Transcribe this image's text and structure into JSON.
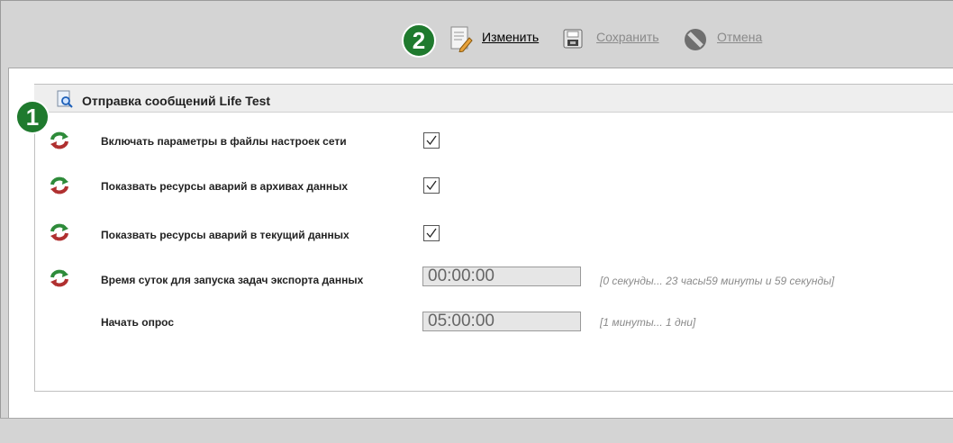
{
  "toolbar": {
    "badge": "2",
    "edit_label": "Изменить",
    "save_label": "Сохранить",
    "cancel_label": "Отмена"
  },
  "panel": {
    "badge": "1",
    "title": "Отправка сообщений Life Test"
  },
  "rows": [
    {
      "label": "Включать параметры  в файлы настроек сети",
      "type": "checkbox",
      "checked": true
    },
    {
      "label": "Показвать ресурсы аварий в архивах данных",
      "type": "checkbox",
      "checked": true
    },
    {
      "label": "Показвать ресурсы аварий в текущий данных",
      "type": "checkbox",
      "checked": true
    },
    {
      "label": "Время суток для запуска задач экспорта данных",
      "type": "field",
      "value": "00:00:00",
      "hint": "[0 секунды... 23 часы59 минуты и 59 секунды]"
    },
    {
      "label": "Начать опрос",
      "type": "field",
      "value": "05:00:00",
      "hint": "[1 минуты... 1 дни]"
    }
  ],
  "colors": {
    "badge": "#1f7a2e",
    "link_active": "#000000",
    "link_disabled": "#8a8a8a"
  }
}
